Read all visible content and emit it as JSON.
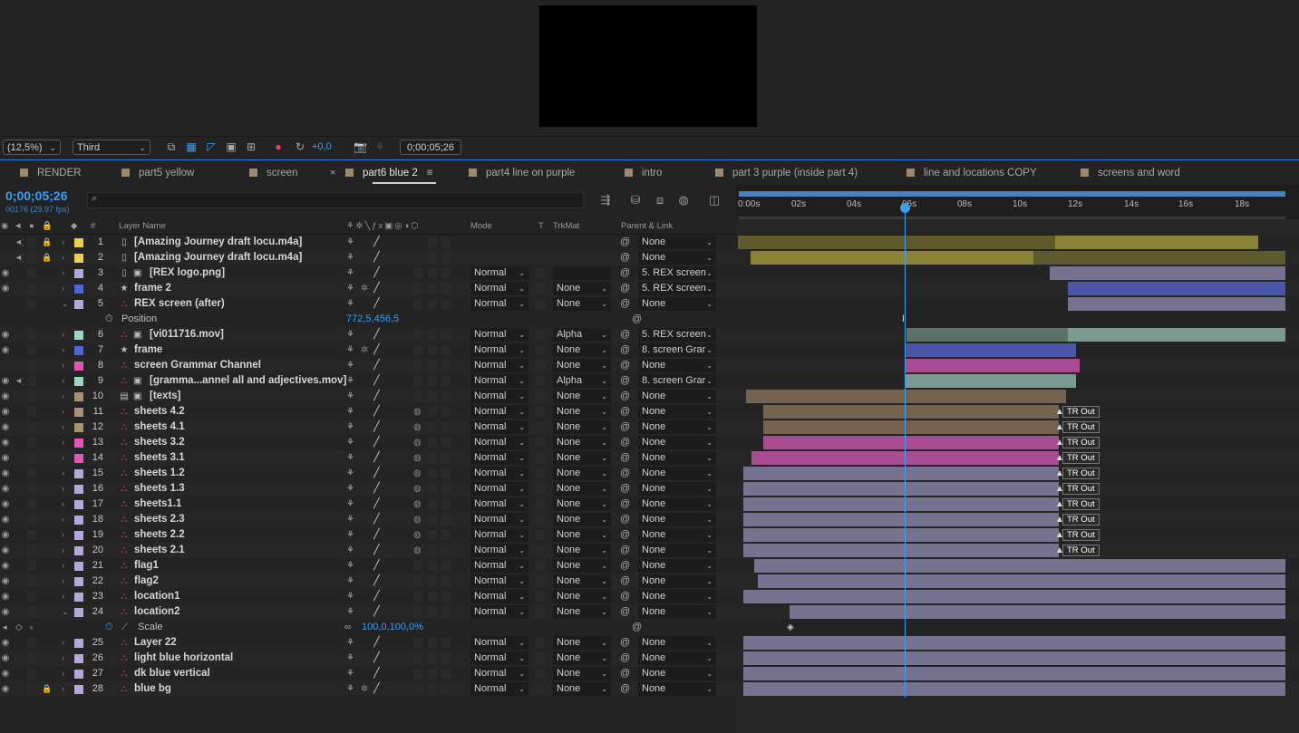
{
  "viewer_bar": {
    "zoom": "(12,5%)",
    "view": "Third",
    "exposure": "+0,0",
    "current_time": "0;00;05;26"
  },
  "tabs": [
    {
      "label": "RENDER",
      "active": false
    },
    {
      "label": "part5 yellow",
      "active": false
    },
    {
      "label": "screen",
      "active": false
    },
    {
      "label": "part6 blue 2",
      "active": true
    },
    {
      "label": "part4 line on purple",
      "active": false
    },
    {
      "label": "intro",
      "active": false
    },
    {
      "label": "part 3 purple (inside part 4)",
      "active": false
    },
    {
      "label": "line and locations COPY",
      "active": false
    },
    {
      "label": "screens and word",
      "active": false
    }
  ],
  "timeline": {
    "timecode": "0;00;05;26",
    "frames_fps": "00176 (29.97 fps)",
    "search_placeholder": "",
    "ruler_labels": [
      "0:00s",
      "02s",
      "04s",
      "06s",
      "08s",
      "10s",
      "12s",
      "14s",
      "16s",
      "18s"
    ]
  },
  "columns": {
    "hash": "#",
    "layer_name": "Layer Name",
    "mode": "Mode",
    "t": "T",
    "trkmat": "TrkMat",
    "parent": "Parent & Link"
  },
  "layers": [
    {
      "num": "1",
      "name": "[Amazing Journey draft locu.m4a]",
      "label_color": "#e8d24a",
      "mode": "",
      "trkmat": "",
      "parent": "None"
    },
    {
      "num": "2",
      "name": "[Amazing Journey draft locu.m4a]",
      "label_color": "#e8d24a",
      "mode": "",
      "trkmat": "",
      "parent": "None"
    },
    {
      "num": "3",
      "name": "[REX logo.png]",
      "label_color": "#b2a9d8",
      "mode": "Normal",
      "trkmat": "",
      "parent": "5. REX screen"
    },
    {
      "num": "4",
      "name": "frame 2",
      "label_color": "#4f63d8",
      "mode": "Normal",
      "trkmat": "None",
      "parent": "5. REX screen"
    },
    {
      "num": "5",
      "name": "REX screen (after)",
      "label_color": "#b2a9d8",
      "mode": "Normal",
      "trkmat": "None",
      "parent": "None"
    },
    {
      "num": "6",
      "name": "[vi011716.mov]",
      "label_color": "#9ed6c6",
      "mode": "Normal",
      "trkmat": "Alpha",
      "parent": "5. REX screen"
    },
    {
      "num": "7",
      "name": "frame",
      "label_color": "#4f63d8",
      "mode": "Normal",
      "trkmat": "None",
      "parent": "8. screen Grar"
    },
    {
      "num": "8",
      "name": "screen Grammar Channel",
      "label_color": "#e055b8",
      "mode": "Normal",
      "trkmat": "None",
      "parent": "None"
    },
    {
      "num": "9",
      "name": "[gramma...annel all and adjectives.mov]",
      "label_color": "#9ed6c6",
      "mode": "Normal",
      "trkmat": "Alpha",
      "parent": "8. screen Grar"
    },
    {
      "num": "10",
      "name": "[texts]",
      "label_color": "#a89070",
      "mode": "Normal",
      "trkmat": "None",
      "parent": "None"
    },
    {
      "num": "11",
      "name": "sheets 4.2",
      "label_color": "#a89070",
      "mode": "Normal",
      "trkmat": "None",
      "parent": "None"
    },
    {
      "num": "12",
      "name": "sheets 4.1",
      "label_color": "#a89070",
      "mode": "Normal",
      "trkmat": "None",
      "parent": "None"
    },
    {
      "num": "13",
      "name": "sheets 3.2",
      "label_color": "#e055b8",
      "mode": "Normal",
      "trkmat": "None",
      "parent": "None"
    },
    {
      "num": "14",
      "name": "sheets 3.1",
      "label_color": "#e055b8",
      "mode": "Normal",
      "trkmat": "None",
      "parent": "None"
    },
    {
      "num": "15",
      "name": "sheets 1.2",
      "label_color": "#b2a9d8",
      "mode": "Normal",
      "trkmat": "None",
      "parent": "None"
    },
    {
      "num": "16",
      "name": "sheets 1.3",
      "label_color": "#b2a9d8",
      "mode": "Normal",
      "trkmat": "None",
      "parent": "None"
    },
    {
      "num": "17",
      "name": "sheets1.1",
      "label_color": "#b2a9d8",
      "mode": "Normal",
      "trkmat": "None",
      "parent": "None"
    },
    {
      "num": "18",
      "name": "sheets 2.3",
      "label_color": "#b2a9d8",
      "mode": "Normal",
      "trkmat": "None",
      "parent": "None"
    },
    {
      "num": "19",
      "name": "sheets 2.2",
      "label_color": "#b2a9d8",
      "mode": "Normal",
      "trkmat": "None",
      "parent": "None"
    },
    {
      "num": "20",
      "name": "sheets 2.1",
      "label_color": "#b2a9d8",
      "mode": "Normal",
      "trkmat": "None",
      "parent": "None"
    },
    {
      "num": "21",
      "name": "flag1",
      "label_color": "#b2a9d8",
      "mode": "Normal",
      "trkmat": "None",
      "parent": "None"
    },
    {
      "num": "22",
      "name": "flag2",
      "label_color": "#b2a9d8",
      "mode": "Normal",
      "trkmat": "None",
      "parent": "None"
    },
    {
      "num": "23",
      "name": "location1",
      "label_color": "#b2a9d8",
      "mode": "Normal",
      "trkmat": "None",
      "parent": "None"
    },
    {
      "num": "24",
      "name": "location2",
      "label_color": "#b2a9d8",
      "mode": "Normal",
      "trkmat": "None",
      "parent": "None"
    },
    {
      "num": "25",
      "name": "Layer 22",
      "label_color": "#b2a9d8",
      "mode": "Normal",
      "trkmat": "None",
      "parent": "None"
    },
    {
      "num": "26",
      "name": "light blue horizontal",
      "label_color": "#b2a9d8",
      "mode": "Normal",
      "trkmat": "None",
      "parent": "None"
    },
    {
      "num": "27",
      "name": "dk blue vertical",
      "label_color": "#b2a9d8",
      "mode": "Normal",
      "trkmat": "None",
      "parent": "None"
    },
    {
      "num": "28",
      "name": "blue bg",
      "label_color": "#b2a9d8",
      "mode": "Normal",
      "trkmat": "None",
      "parent": "None"
    }
  ],
  "properties": {
    "position": {
      "label": "Position",
      "value": "772,5,456,5"
    },
    "scale": {
      "label": "Scale",
      "value": "100,0,100,0%"
    }
  },
  "tr_out_label": "TR Out",
  "colors": {
    "accent": "#3b9ff0",
    "yellow_bar": "#8a8236",
    "lavender_bar": "#77728f",
    "blue_bar": "#4a56a8",
    "pink_bar": "#a84c93",
    "tan_bar": "#74644f",
    "teal_bar": "#7a9a92"
  }
}
